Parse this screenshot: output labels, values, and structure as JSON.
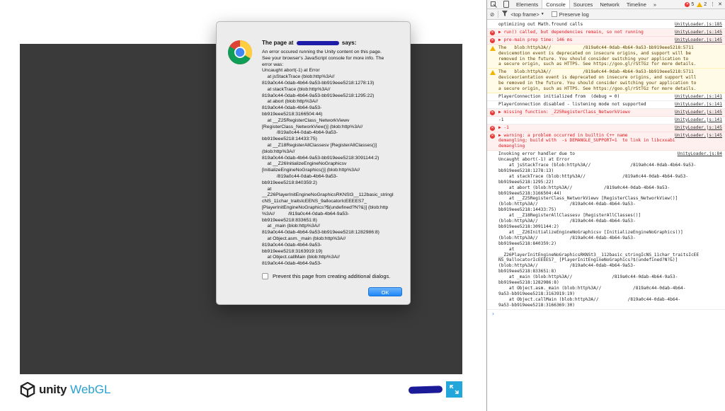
{
  "footer": {
    "unity_word": "unity",
    "webgl_word": "WebGL"
  },
  "dialog": {
    "title_prefix": "The page at",
    "title_suffix": "says:",
    "body": "An error occured running the Unity content on this page.\nSee your browser's JavaScript console for more info. The\nerror was:\nUncaught abort(-1) at Error\n    at jsStackTrace (blob:http%3A//\n819a0c44-0dab-4b64-9a53-bb919eee5218:1278:13)\n    at stackTrace (blob:http%3A//\n819a0c44-0dab-4b64-9a53-bb919eee5218:1295:22)\n    at abort (blob:http%3A//\n819a0c44-0dab-4b64-9a53-\nbb919eee5218:3166504:44)\n    at __Z25RegisterClass_NetworkViewv\n[RegisterClass_NetworkView()] (blob:http%3A//\n           /819a0c44-0dab-4b64-9a53-\nbb919eee5218:14433:75)\n    at __Z18RegisterAllClassesv [RegisterAllClasses()]\n(blob:http%3A//\n819a0c44-0dab-4b64-9a53-bb919eee5218:3091144:2)\n    at __Z26InitializeEngineNoGraphicsv\n[InitializeEngineNoGraphics()] (blob:http%3A//\n           /819a0c44-0dab-4b64-9a53-\nbb919eee5218:840359:2)\n    at\n__Z26PlayerInitEngineNoGraphicsRKNSt3__112basic_stringI\ncNS_11char_traitsIcEENS_9allocatorIcEEEES7_\n[PlayerInitEngineNoGraphics?$(undefined?N?&)] (blob:http\n%3A//          /819a0c44-0dab-4b64-9a53-\nbb919eee5218:833651:8)\n    at _main (blob:http%3A//\n819a0c44-0dab-4b64-9a53-bb919eee5218:1282986:8)\n    at Object.asm._main (blob:http%3A//\n819a0c44-0dab-4b64-9a53-\nbb919eee5218:3163919:19)\n    at Object.callMain (blob:http%3A//\n819a0c44-0dab-4b64-9a53-\nbb919eee5218:3166369:30)",
    "prevent_label": "Prevent this page from creating additional dialogs.",
    "ok_label": "OK"
  },
  "devtools": {
    "tabs": [
      "Elements",
      "Console",
      "Sources",
      "Network",
      "Timeline"
    ],
    "active_tab": "Console",
    "more_tabs": "»",
    "error_count": "5",
    "warning_count": "2",
    "frame_select": "<top frame>",
    "frame_arrow": "▼",
    "preserve_log_label": "Preserve log",
    "messages": [
      {
        "level": "log",
        "text": "optimizing out Math.fround calls",
        "src": "UnityLoader.js:185"
      },
      {
        "level": "error",
        "text": "▶ run() called, but dependencies remain, so not running",
        "src": "UnityLoader.js:145"
      },
      {
        "level": "error",
        "text": "▶ pre-main prep time: 146 ms",
        "src": "UnityLoader.js:145"
      },
      {
        "level": "warn",
        "text": "The   blob:http%3A//            /819a0c44-0dab-4b64-9a53-bb919eee5218:5711\ndevicemotion event is deprecated on insecure origins, and support will be\nremoved in the future. You should consider switching your application to\na secure origin, such as HTTPS. See https://goo.gl/rStTGz for more details.",
        "src": ""
      },
      {
        "level": "warn",
        "text": "The   blob:http%3A//            /819a0c44-0dab-4b64-9a53-bb919eee5218:5711\ndeviceorientation event is deprecated on insecure origins, and support will\nbe removed in the future. You should consider switching your application to\na secure origin, such as HTTPS. See https://goo.gl/rStTGz for more details.",
        "src": ""
      },
      {
        "level": "log",
        "text": "PlayerConnection initialized from  (debug = 0)",
        "src": "UnityLoader.js:141"
      },
      {
        "level": "log",
        "text": "PlayerConnection disabled - listening mode not supported",
        "src": "UnityLoader.js:141"
      },
      {
        "level": "error",
        "text": "▶ missing function: _Z25RegisterClass_NetworkViewv",
        "src": "UnityLoader.js:145"
      },
      {
        "level": "log",
        "text": "-1",
        "src": "UnityLoader.js:141"
      },
      {
        "level": "error",
        "text": "▶ -1",
        "src": "UnityLoader.js:145"
      },
      {
        "level": "error",
        "text": "▶ warning: a problem occurred in builtin C++ name\ndemangling; build with  -s DEMANGLE_SUPPORT=1  to link in libcxxabi\ndemangling",
        "src": "UnityLoader.js:145"
      },
      {
        "level": "log",
        "text": "Invoking error handler due to\nUncaught abort(-1) at Error\n    at jsStackTrace (blob:http%3A//               /819a0c44-0dab-4b64-9a53-\nbb919eee5218:1278:13)\n    at stackTrace (blob:http%3A//              /819a0c44-0dab-4b64-9a53-\nbb919eee5218:1295:22)\n    at abort (blob:http%3A//            /819a0c44-0dab-4b64-9a53-\nbb919eee5218:3166504:44)\n    at __Z25RegisterClass_NetworkViewv [RegisterClass_NetworkView()]\n(blob:http%3A//            /819a0c44-0dab-4b64-9a53-\nbb919eee5218:14433:75)\n    at __Z18RegisterAllClassesv [RegisterAllClasses()]\n(blob:http%3A//            /819a0c44-0dab-4b64-9a53-\nbb919eee5218:3091144:2)\n    at __Z26InitializeEngineNoGraphicsv [InitializeEngineNoGraphics()]\n(blob:http%3A//            /819a0c44-0dab-4b64-9a53-\nbb919eee5218:840359:2)\n    at\n__Z26PlayerInitEngineNoGraphicsRKNSt3__112basic_stringIcNS_11char_traitsIcEE\nNS_9allocatorIcEEEES7_ [PlayerInitEngineNoGraphics?$(undefined?N?&)]\n(blob:http%3A//            /819a0c44-0dab-4b64-9a53-\nbb919eee5218:833651:8)\n    at _main (blob:http%3A//               /819a0c44-0dab-4b64-9a53-\nbb919eee5218:1282986:8)\n    at Object.asm._main (blob:http%3A//            /819a0c44-0dab-4b64-\n9a53-bb919eee5218:3163919:19)\n    at Object.callMain (blob:http%3A//           /819a0c44-0dab-4b64-\n9a53-bb919eee5218:3166369:30)",
        "src": "UnityLoader.js:84"
      }
    ],
    "prompt": "›"
  },
  "colors": {
    "canvas": "#3a3a3a",
    "accent": "#23a6da",
    "error": "#e0191e",
    "redaction": "#1d1da8"
  },
  "icons": {
    "browser_logo": "chrome-logo",
    "fullscreen": "fullscreen-icon",
    "inspect": "inspect-icon",
    "device": "device-mode-icon",
    "clear": "clear-console-icon",
    "filter": "filter-icon"
  }
}
